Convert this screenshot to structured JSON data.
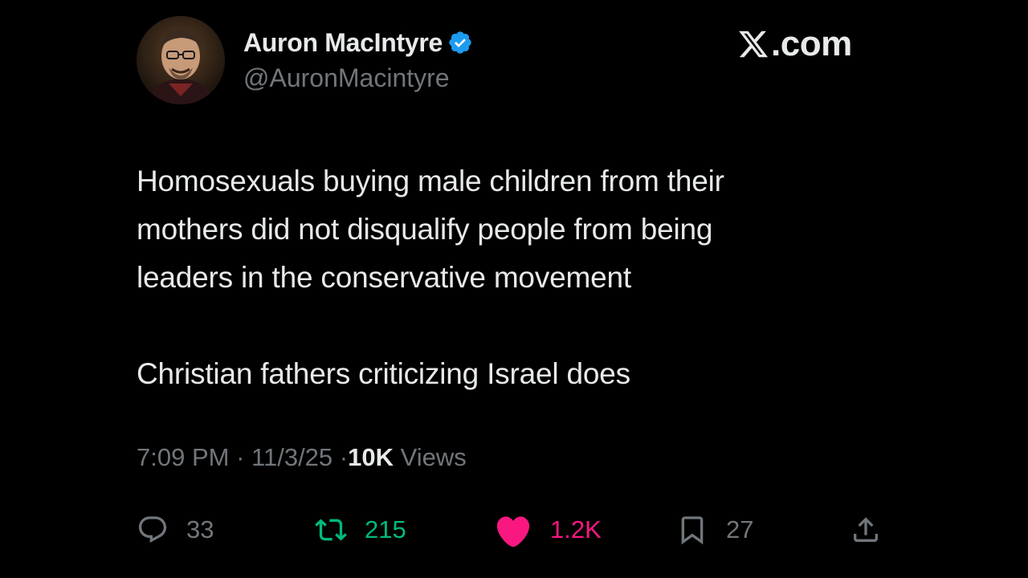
{
  "author": {
    "display_name": "Auron MacIntyre",
    "handle": "@AuronMacintyre",
    "verified": true,
    "verified_color": "#1d9bf0",
    "avatar_icon": "profile-photo"
  },
  "brand": {
    "text": ".com",
    "logo_icon": "x-logo-icon"
  },
  "tweet": {
    "paragraphs": [
      [
        "Homosexuals buying male children from their",
        "mothers did not disqualify people from being",
        "leaders in the conservative movement"
      ],
      [
        "Christian fathers criticizing Israel does"
      ]
    ]
  },
  "meta": {
    "time": "7:09 PM",
    "separator": "·",
    "date": "11/3/25",
    "views_count": "10K",
    "views_label": "Views"
  },
  "actions": {
    "reply": {
      "icon": "reply-icon",
      "count": "33"
    },
    "retweet": {
      "icon": "retweet-icon",
      "count": "215",
      "color": "#00ba7c"
    },
    "like": {
      "icon": "heart-icon",
      "count": "1.2K",
      "color": "#f91880"
    },
    "bookmark": {
      "icon": "bookmark-icon",
      "count": "27"
    },
    "share": {
      "icon": "share-icon"
    }
  },
  "colors": {
    "background": "#000000",
    "text_primary": "#e7e9ea",
    "text_secondary": "#71767b"
  }
}
